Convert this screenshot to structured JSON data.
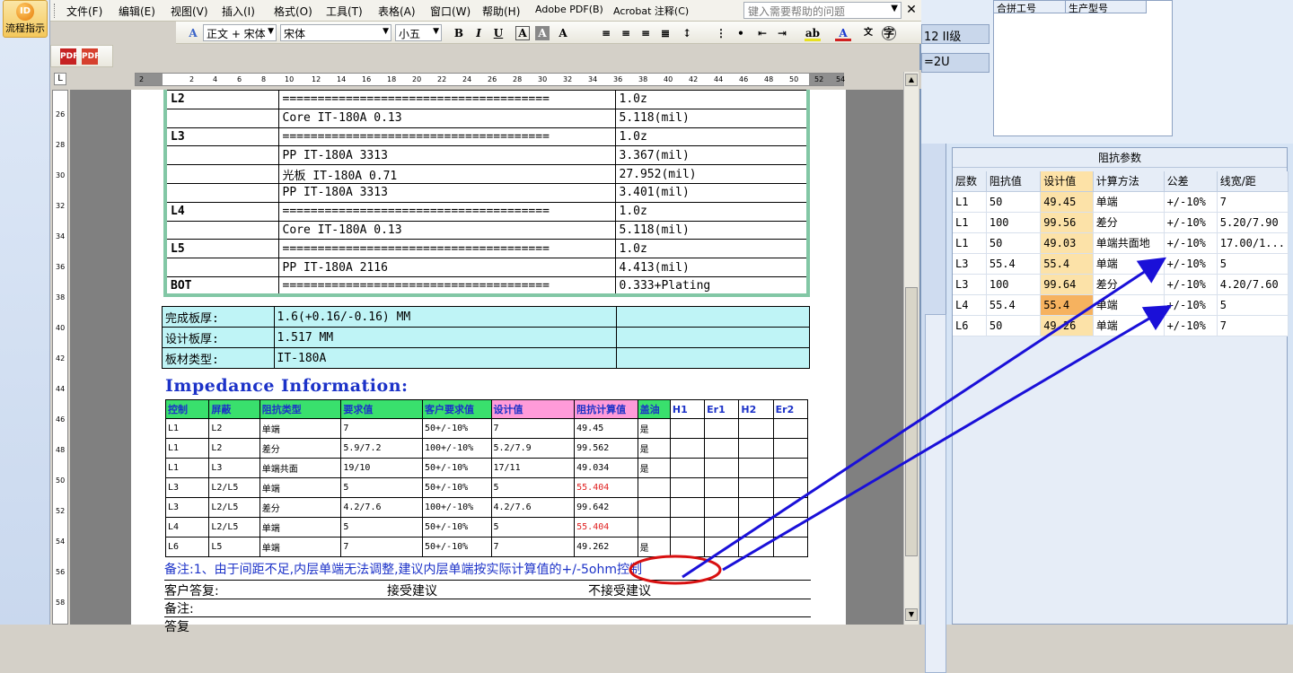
{
  "launcher": {
    "label": "流程指示"
  },
  "menu": {
    "items": [
      "文件(F)",
      "编辑(E)",
      "视图(V)",
      "插入(I)",
      "格式(O)",
      "工具(T)",
      "表格(A)",
      "窗口(W)",
      "帮助(H)",
      "Adobe PDF(B)",
      "Acrobat 注释(C)"
    ],
    "help_placeholder": "键入需要帮助的问题"
  },
  "toolbar": {
    "style": "正文 + 宋体",
    "font": "宋体",
    "size": "小五"
  },
  "ruler": {
    "ticks": [
      "2",
      "2",
      "4",
      "6",
      "8",
      "10",
      "12",
      "14",
      "16",
      "18",
      "20",
      "22",
      "24",
      "26",
      "28",
      "30",
      "32",
      "34",
      "36",
      "38",
      "40",
      "42",
      "44",
      "46",
      "48",
      "50",
      "52",
      "54"
    ]
  },
  "vruler": {
    "ticks": [
      "26",
      "28",
      "30",
      "32",
      "34",
      "36",
      "38",
      "40",
      "42",
      "44",
      "46",
      "48",
      "50",
      "52",
      "54",
      "56",
      "58"
    ]
  },
  "stackup": {
    "rows": [
      [
        "L2",
        "======================================",
        "1.0z"
      ],
      [
        "",
        "Core      IT-180A     0.13",
        "5.118(mil)"
      ],
      [
        "L3",
        "======================================",
        "1.0z"
      ],
      [
        "",
        "PP      IT-180A     3313",
        "3.367(mil)"
      ],
      [
        "",
        "光板      IT-180A     0.71",
        "27.952(mil)"
      ],
      [
        "",
        "PP      IT-180A     3313",
        "3.401(mil)"
      ],
      [
        "L4",
        "======================================",
        "1.0z"
      ],
      [
        "",
        "Core      IT-180A     0.13",
        "5.118(mil)"
      ],
      [
        "L5",
        "======================================",
        "1.0z"
      ],
      [
        "",
        "PP      IT-180A     2116",
        "4.413(mil)"
      ],
      [
        "BOT",
        "======================================",
        "0.333+Plating"
      ]
    ]
  },
  "thickness": {
    "rows": [
      [
        "完成板厚:",
        "1.6(+0.16/-0.16) MM",
        ""
      ],
      [
        "设计板厚:",
        "1.517 MM",
        ""
      ],
      [
        "板材类型:",
        "IT-180A",
        ""
      ]
    ]
  },
  "impedance": {
    "title": "Impedance Information:",
    "headers": [
      "控制",
      "屏蔽",
      "阻抗类型",
      "要求值",
      "客户要求值",
      "设计值",
      "阻抗计算值",
      "盖油",
      "H1",
      "Er1",
      "H2",
      "Er2"
    ],
    "header_colors": [
      "#39e06d",
      "#39e06d",
      "#39e06d",
      "#39e06d",
      "#39e06d",
      "#ff9bd9",
      "#ff9bd9",
      "#39e06d",
      "#ffffff",
      "#ffffff",
      "#ffffff",
      "#ffffff"
    ],
    "rows": [
      [
        "L1",
        "L2",
        "单端",
        "7",
        "50+/-10%",
        "7",
        "49.45",
        "是",
        "",
        "",
        "",
        ""
      ],
      [
        "L1",
        "L2",
        "差分",
        "5.9/7.2",
        "100+/-10%",
        "5.2/7.9",
        "99.562",
        "是",
        "",
        "",
        "",
        ""
      ],
      [
        "L1",
        "L3",
        "单端共面",
        "19/10",
        "50+/-10%",
        "17/11",
        "49.034",
        "是",
        "",
        "",
        "",
        ""
      ],
      [
        "L3",
        "L2/L5",
        "单端",
        "5",
        "50+/-10%",
        "5",
        "55.404",
        "",
        "",
        "",
        "",
        ""
      ],
      [
        "L3",
        "L2/L5",
        "差分",
        "4.2/7.6",
        "100+/-10%",
        "4.2/7.6",
        "99.642",
        "",
        "",
        "",
        "",
        ""
      ],
      [
        "L4",
        "L2/L5",
        "单端",
        "5",
        "50+/-10%",
        "5",
        "55.404",
        "",
        "",
        "",
        "",
        ""
      ],
      [
        "L6",
        "L5",
        "单端",
        "7",
        "50+/-10%",
        "7",
        "49.262",
        "是",
        "",
        "",
        "",
        ""
      ]
    ],
    "red_color": "#e02020"
  },
  "note": "备注:1、由于间距不足,内层单端无法调整,建议内层单端按实际计算值的+/-5ohm控制",
  "reply": {
    "label": "客户答复:",
    "accept": "接受建议",
    "reject": "不接受建议"
  },
  "remark": "备注:",
  "answer": "答复",
  "rightapp": {
    "field1": "12 II级",
    "field2": "=2U",
    "list_headers": [
      "合拼工号",
      "生产型号"
    ],
    "panel_title": "阻抗参数",
    "panel_headers": [
      "层数",
      "阻抗值",
      "设计值",
      "计算方法",
      "公差",
      "线宽/距"
    ],
    "panel_rows": [
      [
        "L1",
        "50",
        "49.45",
        "单端",
        "+/-10%",
        "7"
      ],
      [
        "L1",
        "100",
        "99.56",
        "差分",
        "+/-10%",
        "5.20/7.90"
      ],
      [
        "L1",
        "50",
        "49.03",
        "单端共面地",
        "+/-10%",
        "17.00/1..."
      ],
      [
        "L3",
        "55.4",
        "55.4",
        "单端",
        "+/-10%",
        "5"
      ],
      [
        "L3",
        "100",
        "99.64",
        "差分",
        "+/-10%",
        "4.20/7.60"
      ],
      [
        "L4",
        "55.4",
        "55.4",
        "单端",
        "+/-10%",
        "5"
      ],
      [
        "L6",
        "50",
        "49.26",
        "单端",
        "+/-10%",
        "7"
      ]
    ]
  },
  "colors": {
    "arrow": "#1a10d8",
    "ellipse": "#d81010",
    "accent_blue": "#1c32c8"
  }
}
